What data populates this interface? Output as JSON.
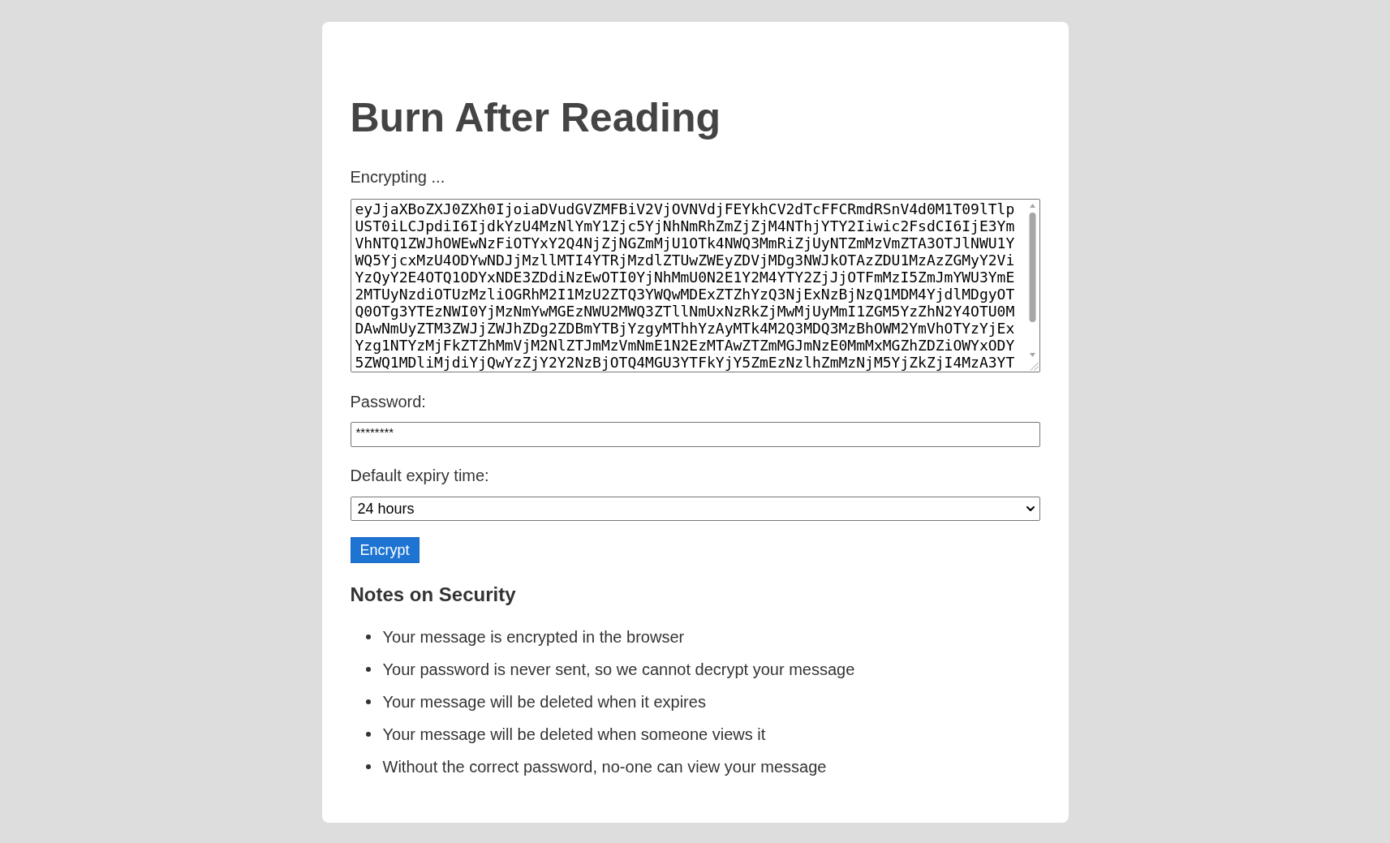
{
  "title": "Burn After Reading",
  "status": "Encrypting ...",
  "ciphertext": "eyJjaXBoZXJ0ZXh0IjoiaDVudGVZMFBiV2VjOVNVdjFEYkhCV2dTcFFCRmdRSnV4d0M1T09lTlpUST0iLCJpdiI6IjdkYzU4MzNlYmY1Zjc5YjNhNmRhZmZjZjM4NThjYTY2Iiwic2FsdCI6IjE3YmVhNTQ1ZWJhOWEwNzFiOTYxY2Q4NjZjNGZmMjU1OTk4NWQ3MmRiZjUyNTZmMzVmZTA3OTJlNWU1YWQ5YjcxMzU4ODYwNDJjMzllMTI4YTRjMzdlZTUwZWEyZDVjMDg3NWJkOTAzZDU1MzAzZGMyY2ViYzQyY2E4OTQ1ODYxNDE3ZDdiNzEwOTI0YjNhMmU0N2E1Y2M4YTY2ZjJjOTFmMzI5ZmJmYWU3YmE2MTUyNzdiOTUzMzliOGRhM2I1MzU2ZTQ3YWQwMDExZTZhYzQ3NjExNzBjNzQ1MDM4YjdlMDgyOTQ0OTg3YTEzNWI0YjMzNmYwMGEzNWU2MWQ3ZTllNmUxNzRkZjMwMjUyMmI1ZGM5YzZhN2Y4OTU0MDAwNmUyZTM3ZWJjZWJhZDg2ZDBmYTBjYzgyMThhYzAyMTk4M2Q3MDQ3MzBhOWM2YmVhOTYzYjExYzg1NTYzMjFkZTZhMmVjM2NlZTJmMzVmNmE1N2EzMTAwZTZmMGJmNzE0MmMxMGZhZDZiOWYxODY5ZWQ1MDliMjdiYjQwYzZjY2Y2NzBjOTQ4MGU3YTFkYjY5ZmEzNzlhZmMzNjM5YjZkZjI4MzA3YT",
  "password": {
    "label": "Password:",
    "value": "********"
  },
  "expiry": {
    "label": "Default expiry time:",
    "value": "24 hours"
  },
  "submit_button": "Encrypt",
  "notes": {
    "title": "Notes on Security",
    "items": [
      "Your message is encrypted in the browser",
      "Your password is never sent, so we cannot decrypt your message",
      "Your message will be deleted when it expires",
      "Your message will be deleted when someone views it",
      "Without the correct password, no-one can view your message"
    ]
  }
}
